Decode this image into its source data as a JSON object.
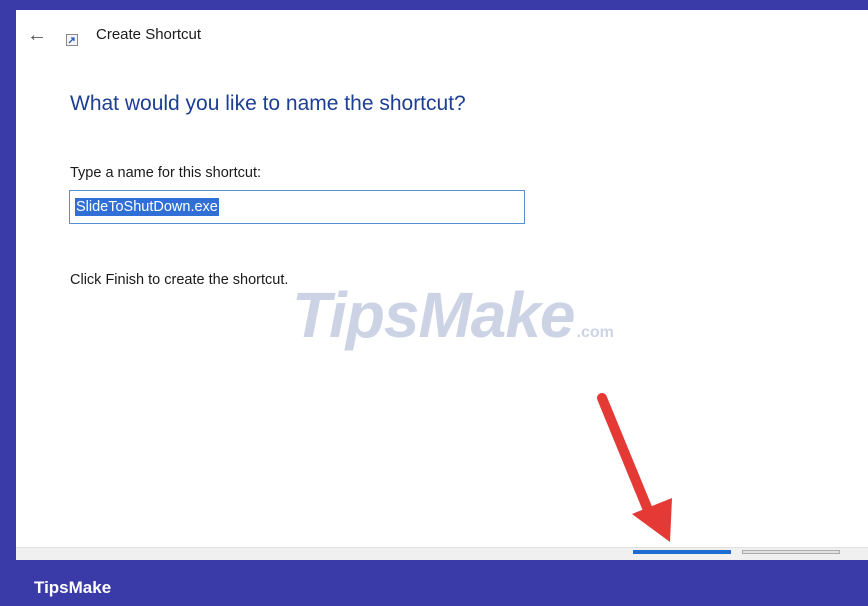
{
  "window": {
    "title": "Create Shortcut",
    "back_icon": "back-arrow-icon",
    "shortcut_icon": "shortcut-arrow-icon"
  },
  "main": {
    "heading": "What would you like to name the shortcut?",
    "name_label": "Type a name for this shortcut:",
    "name_value": "SlideToShutDown.exe",
    "finish_hint": "Click Finish to create the shortcut."
  },
  "watermark": {
    "text": "TipsMake",
    "suffix": ".com"
  },
  "footer": {
    "brand": "TipsMake"
  },
  "colors": {
    "heading": "#1c3f94",
    "selection": "#2f6fd6",
    "frame": "#3a3aa8",
    "annotation_arrow": "#e53935"
  }
}
